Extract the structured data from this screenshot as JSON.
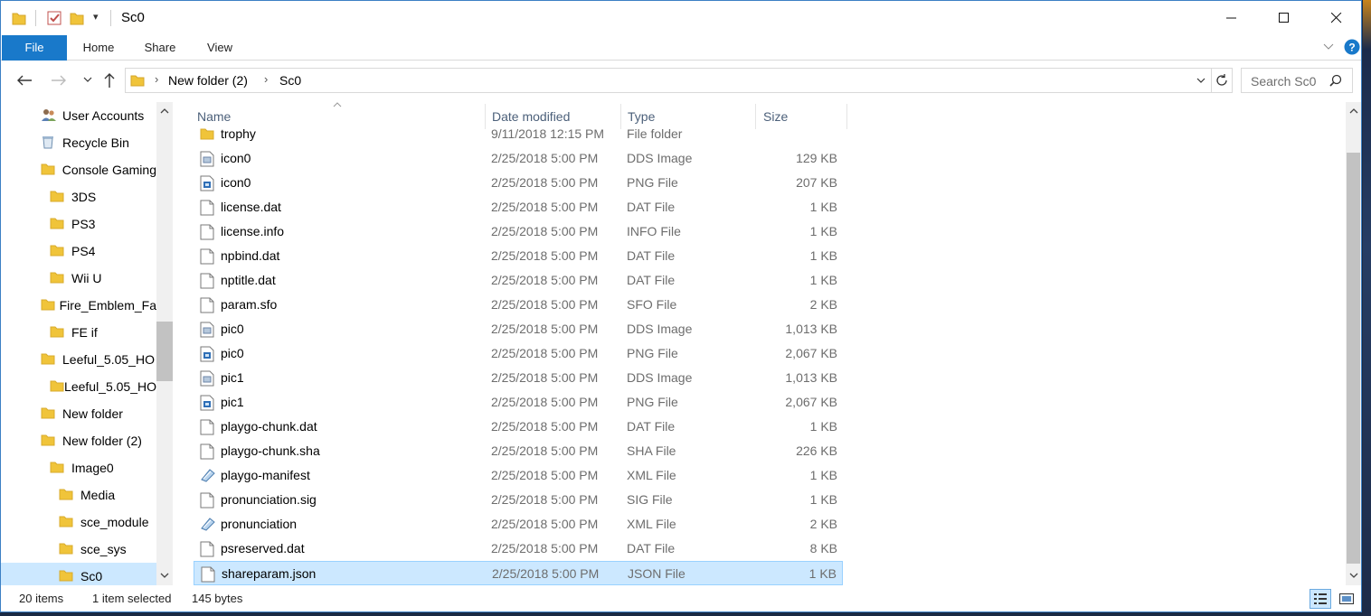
{
  "window": {
    "title": "Sc0",
    "qat_dropdown": "▾"
  },
  "ribbon": {
    "tabs": [
      "File",
      "Home",
      "Share",
      "View"
    ]
  },
  "address_bar": {
    "segments": [
      "New folder (2)",
      "Sc0"
    ]
  },
  "search": {
    "placeholder": "Search Sc0"
  },
  "nav_pane": {
    "items": [
      {
        "label": "User Accounts",
        "icon": "users-icon",
        "indent": 0
      },
      {
        "label": "Recycle Bin",
        "icon": "recycle-bin-icon",
        "indent": 0
      },
      {
        "label": "Console Gaming",
        "icon": "folder-icon",
        "indent": 0
      },
      {
        "label": "3DS",
        "icon": "folder-icon",
        "indent": 1
      },
      {
        "label": "PS3",
        "icon": "folder-icon",
        "indent": 1
      },
      {
        "label": "PS4",
        "icon": "folder-icon",
        "indent": 1
      },
      {
        "label": "Wii U",
        "icon": "folder-icon",
        "indent": 1
      },
      {
        "label": "Fire_Emblem_Fa",
        "icon": "folder-icon",
        "indent": 0
      },
      {
        "label": "FE if",
        "icon": "folder-icon",
        "indent": 1
      },
      {
        "label": "Leeful_5.05_HO",
        "icon": "folder-icon",
        "indent": 0
      },
      {
        "label": "Leeful_5.05_HO",
        "icon": "folder-icon",
        "indent": 1
      },
      {
        "label": "New folder",
        "icon": "folder-icon",
        "indent": 0
      },
      {
        "label": "New folder (2)",
        "icon": "folder-icon",
        "indent": 0
      },
      {
        "label": "Image0",
        "icon": "folder-icon",
        "indent": 1
      },
      {
        "label": "Media",
        "icon": "folder-icon",
        "indent": 2
      },
      {
        "label": "sce_module",
        "icon": "folder-icon",
        "indent": 2
      },
      {
        "label": "sce_sys",
        "icon": "folder-icon",
        "indent": 2
      },
      {
        "label": "Sc0",
        "icon": "folder-icon",
        "indent": 2,
        "selected": true
      }
    ]
  },
  "file_list": {
    "columns": [
      "Name",
      "Date modified",
      "Type",
      "Size"
    ],
    "rows": [
      {
        "name": "trophy",
        "date": "9/11/2018 12:15 PM",
        "type": "File folder",
        "size": "",
        "icon": "folder-icon"
      },
      {
        "name": "icon0",
        "date": "2/25/2018 5:00 PM",
        "type": "DDS Image",
        "size": "129 KB",
        "icon": "dds-file-icon"
      },
      {
        "name": "icon0",
        "date": "2/25/2018 5:00 PM",
        "type": "PNG File",
        "size": "207 KB",
        "icon": "png-file-icon"
      },
      {
        "name": "license.dat",
        "date": "2/25/2018 5:00 PM",
        "type": "DAT File",
        "size": "1 KB",
        "icon": "file-icon"
      },
      {
        "name": "license.info",
        "date": "2/25/2018 5:00 PM",
        "type": "INFO File",
        "size": "1 KB",
        "icon": "file-icon"
      },
      {
        "name": "npbind.dat",
        "date": "2/25/2018 5:00 PM",
        "type": "DAT File",
        "size": "1 KB",
        "icon": "file-icon"
      },
      {
        "name": "nptitle.dat",
        "date": "2/25/2018 5:00 PM",
        "type": "DAT File",
        "size": "1 KB",
        "icon": "file-icon"
      },
      {
        "name": "param.sfo",
        "date": "2/25/2018 5:00 PM",
        "type": "SFO File",
        "size": "2 KB",
        "icon": "file-icon"
      },
      {
        "name": "pic0",
        "date": "2/25/2018 5:00 PM",
        "type": "DDS Image",
        "size": "1,013 KB",
        "icon": "dds-file-icon"
      },
      {
        "name": "pic0",
        "date": "2/25/2018 5:00 PM",
        "type": "PNG File",
        "size": "2,067 KB",
        "icon": "png-file-icon"
      },
      {
        "name": "pic1",
        "date": "2/25/2018 5:00 PM",
        "type": "DDS Image",
        "size": "1,013 KB",
        "icon": "dds-file-icon"
      },
      {
        "name": "pic1",
        "date": "2/25/2018 5:00 PM",
        "type": "PNG File",
        "size": "2,067 KB",
        "icon": "png-file-icon"
      },
      {
        "name": "playgo-chunk.dat",
        "date": "2/25/2018 5:00 PM",
        "type": "DAT File",
        "size": "1 KB",
        "icon": "file-icon"
      },
      {
        "name": "playgo-chunk.sha",
        "date": "2/25/2018 5:00 PM",
        "type": "SHA File",
        "size": "226 KB",
        "icon": "file-icon"
      },
      {
        "name": "playgo-manifest",
        "date": "2/25/2018 5:00 PM",
        "type": "XML File",
        "size": "1 KB",
        "icon": "xml-file-icon"
      },
      {
        "name": "pronunciation.sig",
        "date": "2/25/2018 5:00 PM",
        "type": "SIG File",
        "size": "1 KB",
        "icon": "file-icon"
      },
      {
        "name": "pronunciation",
        "date": "2/25/2018 5:00 PM",
        "type": "XML File",
        "size": "2 KB",
        "icon": "xml-file-icon"
      },
      {
        "name": "psreserved.dat",
        "date": "2/25/2018 5:00 PM",
        "type": "DAT File",
        "size": "8 KB",
        "icon": "file-icon"
      },
      {
        "name": "shareparam.json",
        "date": "2/25/2018 5:00 PM",
        "type": "JSON File",
        "size": "1 KB",
        "icon": "file-icon",
        "selected": true
      }
    ]
  },
  "status_bar": {
    "item_count": "20 items",
    "selection": "1 item selected",
    "selection_size": "145 bytes"
  },
  "colors": {
    "accent": "#1979ca",
    "selection": "#cce8ff",
    "folder": "#f0c43a",
    "header_text": "#4c607a"
  }
}
